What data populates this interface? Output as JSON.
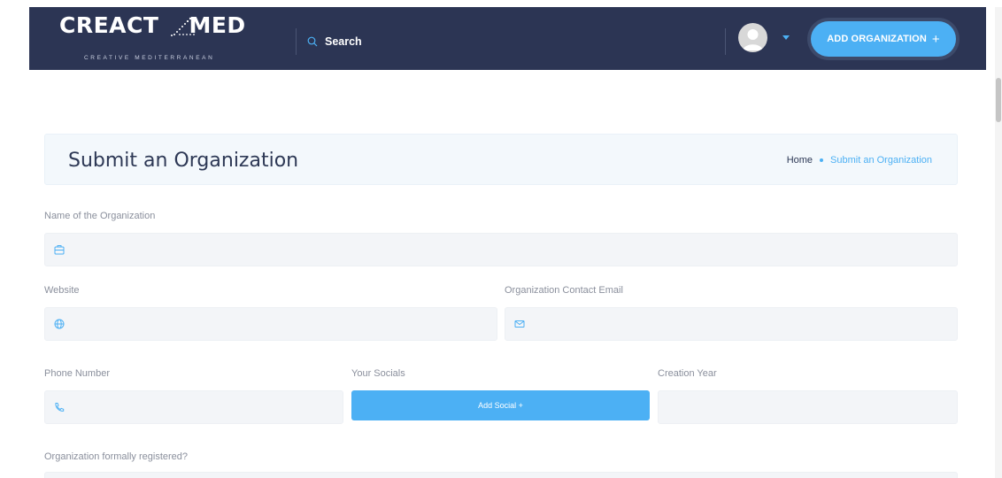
{
  "header": {
    "logo_text": "CREACT MED",
    "logo_subtitle": "CREATIVE MEDITERRANEAN",
    "search_label": "Search",
    "add_org_label": "ADD ORGANIZATION",
    "add_org_icon": "plus",
    "colors": {
      "navbar": "#2c3554",
      "accent": "#4cb0f4"
    }
  },
  "title_box": {
    "title": "Submit an Organization",
    "breadcrumb_home": "Home",
    "breadcrumb_current": "Submit an Organization"
  },
  "form": {
    "name_label": "Name of the Organization",
    "name_value": "",
    "website_label": "Website",
    "website_value": "",
    "email_label": "Organization Contact Email",
    "email_value": "",
    "phone_label": "Phone Number",
    "phone_value": "",
    "socials_label": "Your Socials",
    "add_social_label": "Add Social +",
    "year_label": "Creation Year",
    "year_value": "",
    "registered_label": "Organization formally registered?"
  }
}
